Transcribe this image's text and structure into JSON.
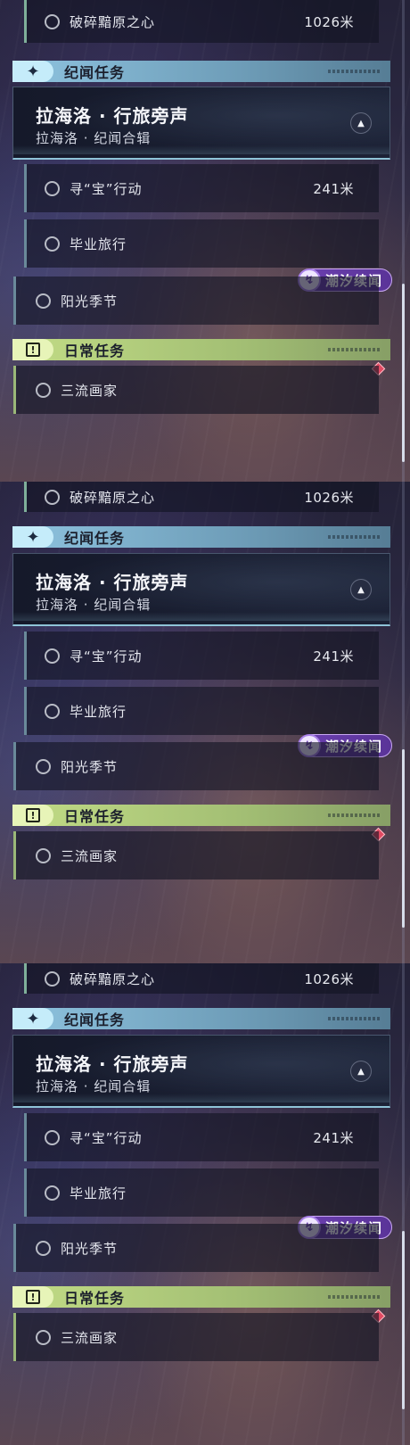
{
  "panels": [
    {
      "top_quest": {
        "label": "破碎黯原之心",
        "distance": "1026米"
      },
      "category_story": {
        "label": "纪闻任务",
        "icon": "sparkle-icon"
      },
      "quest_card": {
        "title": "拉海洛 · 行旅旁声",
        "subtitle": "拉海洛 · 纪闻合辑",
        "collapse_icon": "chevron-up-icon"
      },
      "quests": [
        {
          "label": "寻“宝”行动",
          "distance": "241米"
        },
        {
          "label": "毕业旅行",
          "distance": ""
        }
      ],
      "tide_badge": {
        "label": "潮汐续闻",
        "icon": "tide-icon"
      },
      "sunshine_quest": {
        "label": "阳光季节"
      },
      "category_daily": {
        "label": "日常任务",
        "icon": "alert-icon"
      },
      "daily_quest": {
        "label": "三流画家"
      }
    },
    {
      "top_quest": {
        "label": "破碎黯原之心",
        "distance": "1026米"
      },
      "category_story": {
        "label": "纪闻任务",
        "icon": "sparkle-icon"
      },
      "quest_card": {
        "title": "拉海洛 · 行旅旁声",
        "subtitle": "拉海洛 · 纪闻合辑",
        "collapse_icon": "chevron-up-icon"
      },
      "quests": [
        {
          "label": "寻“宝”行动",
          "distance": "241米"
        },
        {
          "label": "毕业旅行",
          "distance": ""
        }
      ],
      "tide_badge": {
        "label": "潮汐续闻",
        "icon": "tide-icon"
      },
      "sunshine_quest": {
        "label": "阳光季节"
      },
      "category_daily": {
        "label": "日常任务",
        "icon": "alert-icon"
      },
      "daily_quest": {
        "label": "三流画家"
      }
    },
    {
      "top_quest": {
        "label": "破碎黯原之心",
        "distance": "1026米"
      },
      "category_story": {
        "label": "纪闻任务",
        "icon": "sparkle-icon"
      },
      "quest_card": {
        "title": "拉海洛 · 行旅旁声",
        "subtitle": "拉海洛 · 纪闻合辑",
        "collapse_icon": "chevron-up-icon"
      },
      "quests": [
        {
          "label": "寻“宝”行动",
          "distance": "241米"
        },
        {
          "label": "毕业旅行",
          "distance": ""
        }
      ],
      "tide_badge": {
        "label": "潮汐续闻",
        "icon": "tide-icon"
      },
      "sunshine_quest": {
        "label": "阳光季节"
      },
      "category_daily": {
        "label": "日常任务",
        "icon": "alert-icon"
      },
      "daily_quest": {
        "label": "三流画家"
      }
    }
  ],
  "colors": {
    "story_accent": "#8ec3df",
    "daily_accent": "#c2dc86",
    "tide_badge": "#6b3fb0",
    "marker": "#e04a62"
  }
}
